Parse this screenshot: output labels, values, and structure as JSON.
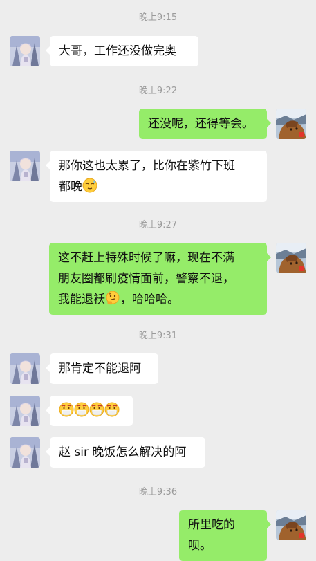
{
  "chat": [
    {
      "type": "time",
      "text": "晚上9:15"
    },
    {
      "type": "msg",
      "side": "left",
      "text": "大哥，工作还没做完奥"
    },
    {
      "type": "time",
      "text": "晚上9:22"
    },
    {
      "type": "msg",
      "side": "right",
      "text": "还没呢，还得等会。"
    },
    {
      "type": "msg",
      "side": "left",
      "line1": "那你这也太累了，比你在紫竹下班",
      "line2": "都晚",
      "emoji": "relieved-sweat-emoji"
    },
    {
      "type": "time",
      "text": "晚上9:27"
    },
    {
      "type": "msg",
      "side": "right",
      "line1": "这不赶上特殊时候了嘛，现在不满",
      "line2": "朋友圈都刷疫情面前，警察不退，",
      "line3a": "我能退袄",
      "emoji": "thinking-emoji",
      "line3b": "，哈哈哈。"
    },
    {
      "type": "time",
      "text": "晚上9:31"
    },
    {
      "type": "msg",
      "side": "left",
      "text": "那肯定不能退阿"
    },
    {
      "type": "msg",
      "side": "left",
      "emojis": [
        "mask-emoji",
        "mask-emoji",
        "mask-emoji",
        "mask-emoji"
      ]
    },
    {
      "type": "msg",
      "side": "left",
      "text": "赵 sir 晚饭怎么解决的阿"
    },
    {
      "type": "time",
      "text": "晚上9:36"
    },
    {
      "type": "msg",
      "side": "right",
      "text": "所里吃的呗。"
    }
  ],
  "colors": {
    "background": "#ededed",
    "outgoing_bubble": "#95ec69",
    "incoming_bubble": "#ffffff",
    "timestamp": "#9b9b9b"
  }
}
